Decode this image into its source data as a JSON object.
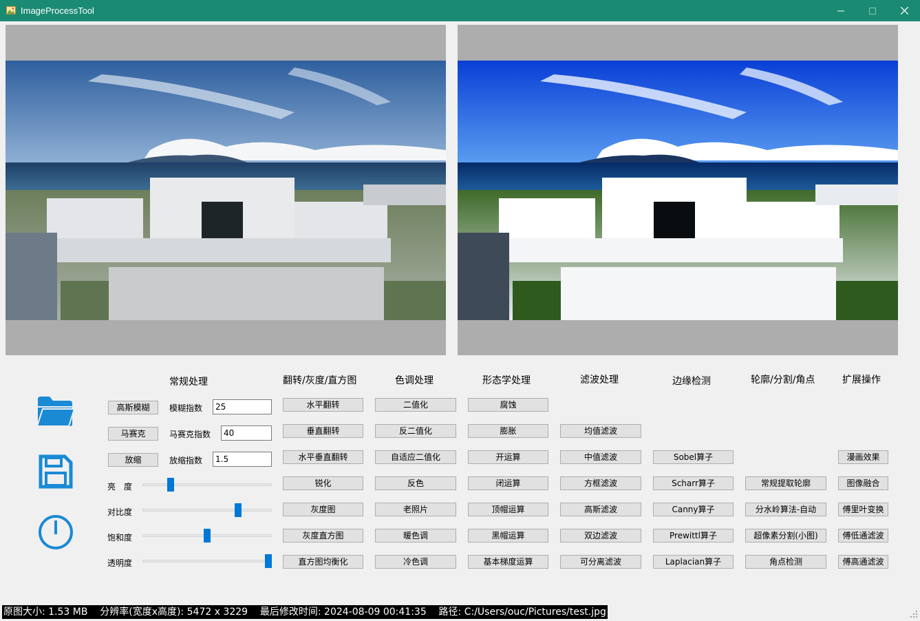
{
  "window": {
    "title": "ImageProcessTool",
    "icon": "app-image-icon",
    "controls": [
      "minimize-icon",
      "maximize-icon",
      "close-icon"
    ]
  },
  "colors": {
    "titlebar": "#1b8a73",
    "accent": "#0078d7",
    "icon_blue": "#1a8ad5",
    "panel_bg": "#adadad"
  },
  "images": {
    "original": "harbor-building-photo-original",
    "processed": "harbor-building-photo-enhanced"
  },
  "icons": {
    "open": "folder-icon",
    "save": "save-icon",
    "power": "power-icon"
  },
  "sections": {
    "general": "常规处理",
    "flip": "翻转/灰度/直方图",
    "tone": "色调处理",
    "morph": "形态学处理",
    "filter": "滤波处理",
    "edge": "边缘检测",
    "contour": "轮廓/分割/角点",
    "ext": "扩展操作"
  },
  "general": {
    "blur_btn": "高斯模糊",
    "blur_label": "模糊指数",
    "blur_value": "25",
    "mosaic_btn": "马赛克",
    "mosaic_label": "马赛克指数",
    "mosaic_value": "40",
    "zoom_btn": "放缩",
    "zoom_label": "放缩指数",
    "zoom_value": "1.5"
  },
  "sliders": {
    "brightness_label": "亮　度",
    "brightness": 0.2,
    "contrast_label": "对比度",
    "contrast": 0.75,
    "saturation_label": "饱和度",
    "saturation": 0.5,
    "opacity_label": "透明度",
    "opacity": 1.0
  },
  "flip": [
    "水平翻转",
    "垂直翻转",
    "水平垂直翻转",
    "锐化",
    "灰度图",
    "灰度直方图",
    "直方图均衡化"
  ],
  "tone": [
    "二值化",
    "反二值化",
    "自适应二值化",
    "反色",
    "老照片",
    "暖色调",
    "冷色调"
  ],
  "morph": [
    "腐蚀",
    "膨胀",
    "开运算",
    "闭运算",
    "顶帽运算",
    "黑帽运算",
    "基本梯度运算"
  ],
  "filter": [
    "均值滤波",
    "中值滤波",
    "方框滤波",
    "高斯滤波",
    "双边滤波",
    "可分离滤波"
  ],
  "edge": [
    "Sobel算子",
    "Scharr算子",
    "Canny算子",
    "Prewittl算子",
    "Laplacian算子"
  ],
  "contour": [
    "常规提取轮廓",
    "分水岭算法-自动",
    "超像素分割(小图)",
    "角点检测"
  ],
  "ext": [
    "漫画效果",
    "图像融合",
    "傅里叶变换",
    "傅低通滤波",
    "傅高通滤波"
  ],
  "status": {
    "text": "原图大小: 1.53 MB    分辨率(宽度x高度): 5472 x 3229    最后修改时间: 2024-08-09 00:41:35    路径: C:/Users/ouc/Pictures/test.jpg"
  }
}
